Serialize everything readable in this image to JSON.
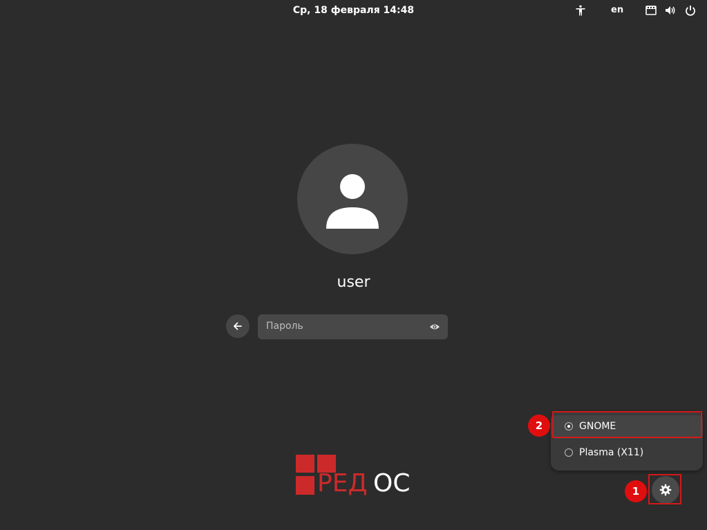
{
  "topbar": {
    "clock": "Ср, 18 февраля  14:48",
    "language": "en",
    "icons": [
      "accessibility-icon",
      "keyboard-icon",
      "volume-icon",
      "power-icon"
    ]
  },
  "login": {
    "username": "user",
    "password_placeholder": "Пароль"
  },
  "logo": {
    "text_red": "РЕД",
    "text_white": "ОС",
    "brand_color": "#cc2a2a"
  },
  "session_menu": {
    "items": [
      {
        "label": "GNOME",
        "selected": true
      },
      {
        "label": "Plasma (X11)",
        "selected": false
      }
    ]
  },
  "callouts": [
    "1",
    "2"
  ],
  "colors": {
    "background": "#2c2c2c",
    "annotation": "#e00e0e"
  }
}
